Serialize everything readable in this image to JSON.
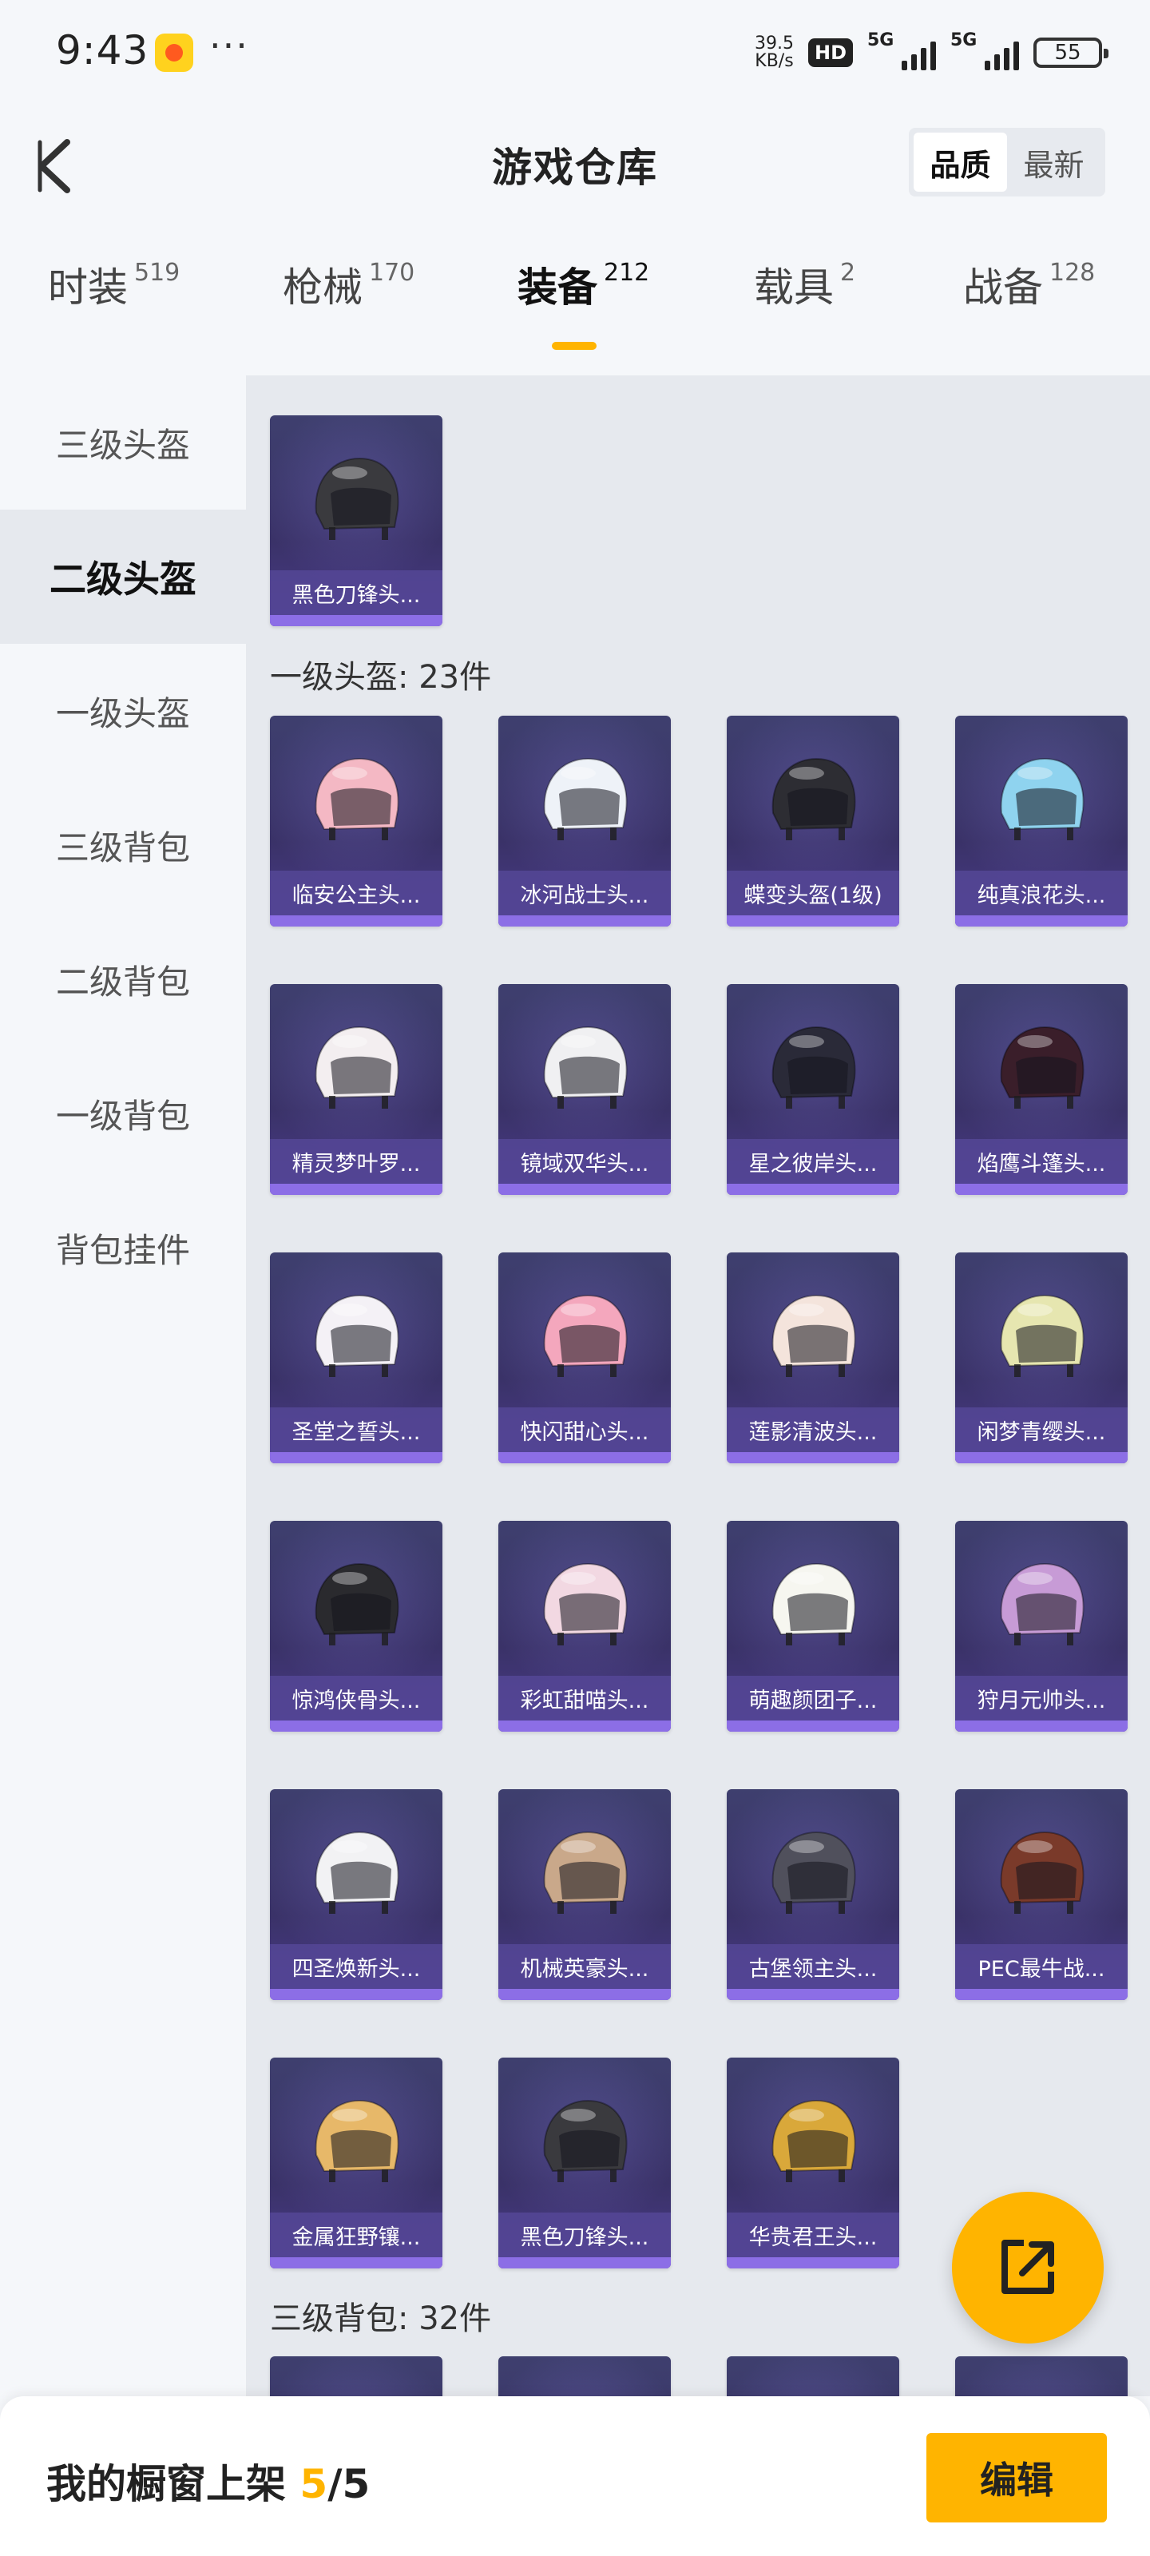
{
  "status": {
    "time": "9:43",
    "speed_value": "39.5",
    "speed_unit": "KB/s",
    "hd_label": "HD",
    "signal1": "5G",
    "signal2": "5G",
    "battery": "55"
  },
  "header": {
    "title": "游戏仓库",
    "sort_quality": "品质",
    "sort_latest": "最新"
  },
  "categories": [
    {
      "name": "时装",
      "count": "519"
    },
    {
      "name": "枪械",
      "count": "170"
    },
    {
      "name": "装备",
      "count": "212"
    },
    {
      "name": "载具",
      "count": "2"
    },
    {
      "name": "战备",
      "count": "128"
    }
  ],
  "side_menu": [
    "三级头盔",
    "二级头盔",
    "一级头盔",
    "三级背包",
    "二级背包",
    "一级背包",
    "背包挂件"
  ],
  "sections": [
    {
      "title": "一级头盔: 23件"
    },
    {
      "title": "三级背包: 32件"
    }
  ],
  "items": [
    {
      "name": "黑色刀锋头...",
      "color": "#3a3a3e"
    },
    {
      "name": "临安公主头...",
      "color": "#f4b8c4"
    },
    {
      "name": "冰河战士头...",
      "color": "#eef2f8"
    },
    {
      "name": "蝶变头盔(1级)",
      "color": "#2d2d33"
    },
    {
      "name": "纯真浪花头...",
      "color": "#8fd3ef"
    },
    {
      "name": "精灵梦叶罗...",
      "color": "#f3eef0"
    },
    {
      "name": "镜域双华头...",
      "color": "#f0f0f2"
    },
    {
      "name": "星之彼岸头...",
      "color": "#2a2a38"
    },
    {
      "name": "焰鹰斗篷头...",
      "color": "#3a1e2a"
    },
    {
      "name": "圣堂之誓头...",
      "color": "#f4f1f6"
    },
    {
      "name": "快闪甜心头...",
      "color": "#f4a7bd"
    },
    {
      "name": "莲影清波头...",
      "color": "#f4e4dc"
    },
    {
      "name": "闲梦青缨头...",
      "color": "#e6e6b0"
    },
    {
      "name": "惊鸿侠骨头...",
      "color": "#2a2a2e"
    },
    {
      "name": "彩虹甜喵头...",
      "color": "#f2d8e2"
    },
    {
      "name": "萌趣颜团子...",
      "color": "#f6f6f0"
    },
    {
      "name": "狩月元帅头...",
      "color": "#c79bd6"
    },
    {
      "name": "四圣焕新头...",
      "color": "#f2f2f4"
    },
    {
      "name": "机械英豪头...",
      "color": "#c9a88a"
    },
    {
      "name": "古堡领主头...",
      "color": "#50505c"
    },
    {
      "name": "PEC最牛战...",
      "color": "#7a3a2a"
    },
    {
      "name": "金属狂野镶...",
      "color": "#e7b869"
    },
    {
      "name": "黑色刀锋头...",
      "color": "#3a3a3e"
    },
    {
      "name": "华贵君王头...",
      "color": "#d9a83a"
    }
  ],
  "bottom": {
    "shelf_label": "我的橱窗上架",
    "shelf_current": "5",
    "shelf_total": "/5",
    "edit_label": "编辑"
  },
  "accent_color": "#ffb400"
}
